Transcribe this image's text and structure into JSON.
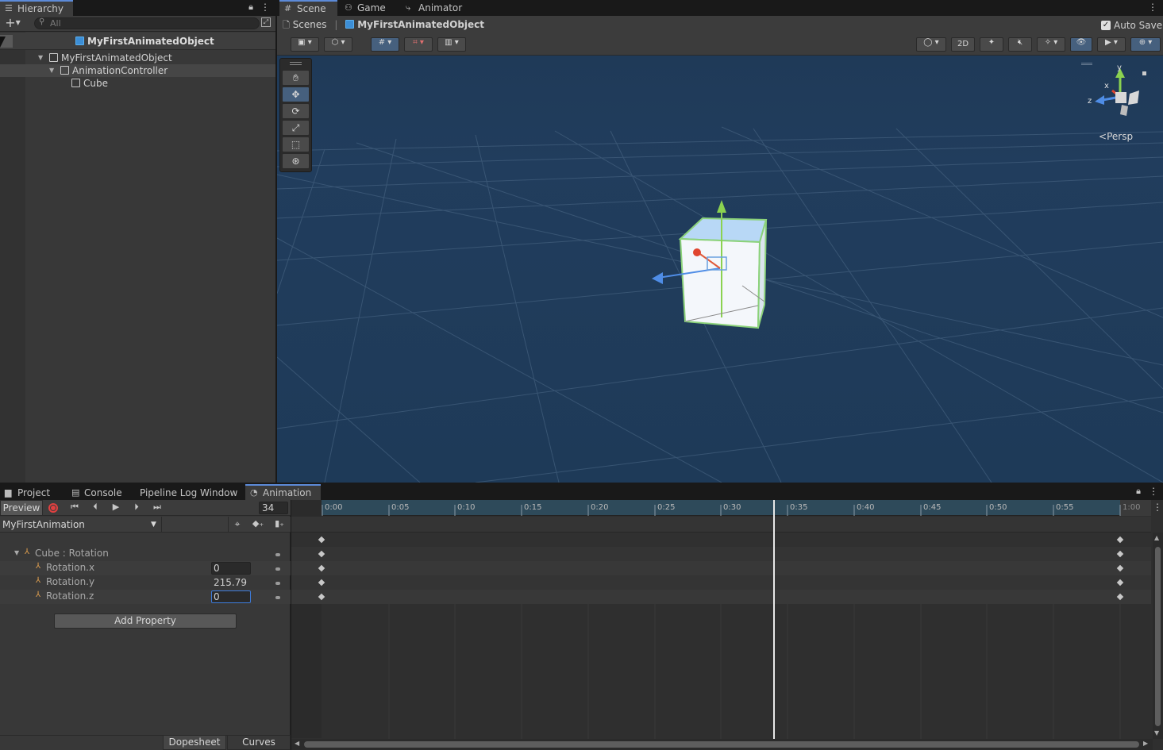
{
  "hierarchy": {
    "tab_label": "Hierarchy",
    "search_placeholder": "All",
    "scene_root": "MyFirstAnimatedObject",
    "items": [
      "MyFirstAnimatedObject",
      "AnimationController",
      "Cube"
    ]
  },
  "scene_tabs": [
    "Scene",
    "Game",
    "Animator"
  ],
  "breadcrumb": {
    "root": "Scenes",
    "current": "MyFirstAnimatedObject"
  },
  "auto_save_label": "Auto Save",
  "toolbar": {
    "mode_2d": "2D"
  },
  "gizmo": {
    "y": "y",
    "x": "x",
    "z": "z",
    "projection": "Persp"
  },
  "bottom_tabs": [
    "Project",
    "Console",
    "Pipeline Log Window",
    "Animation"
  ],
  "animation": {
    "preview_label": "Preview",
    "frame": "34",
    "clip": "MyFirstAnimation",
    "property_group": "Cube : Rotation",
    "properties": [
      {
        "name": "Rotation.x",
        "value": "0"
      },
      {
        "name": "Rotation.y",
        "value": "215.79"
      },
      {
        "name": "Rotation.z",
        "value": "0"
      }
    ],
    "add_property": "Add Property",
    "dopesheet": "Dopesheet",
    "curves": "Curves",
    "ruler": [
      "0:00",
      "0:05",
      "0:10",
      "0:15",
      "0:20",
      "0:25",
      "0:30",
      "0:35",
      "0:40",
      "0:45",
      "0:50",
      "0:55",
      "1:00"
    ]
  }
}
